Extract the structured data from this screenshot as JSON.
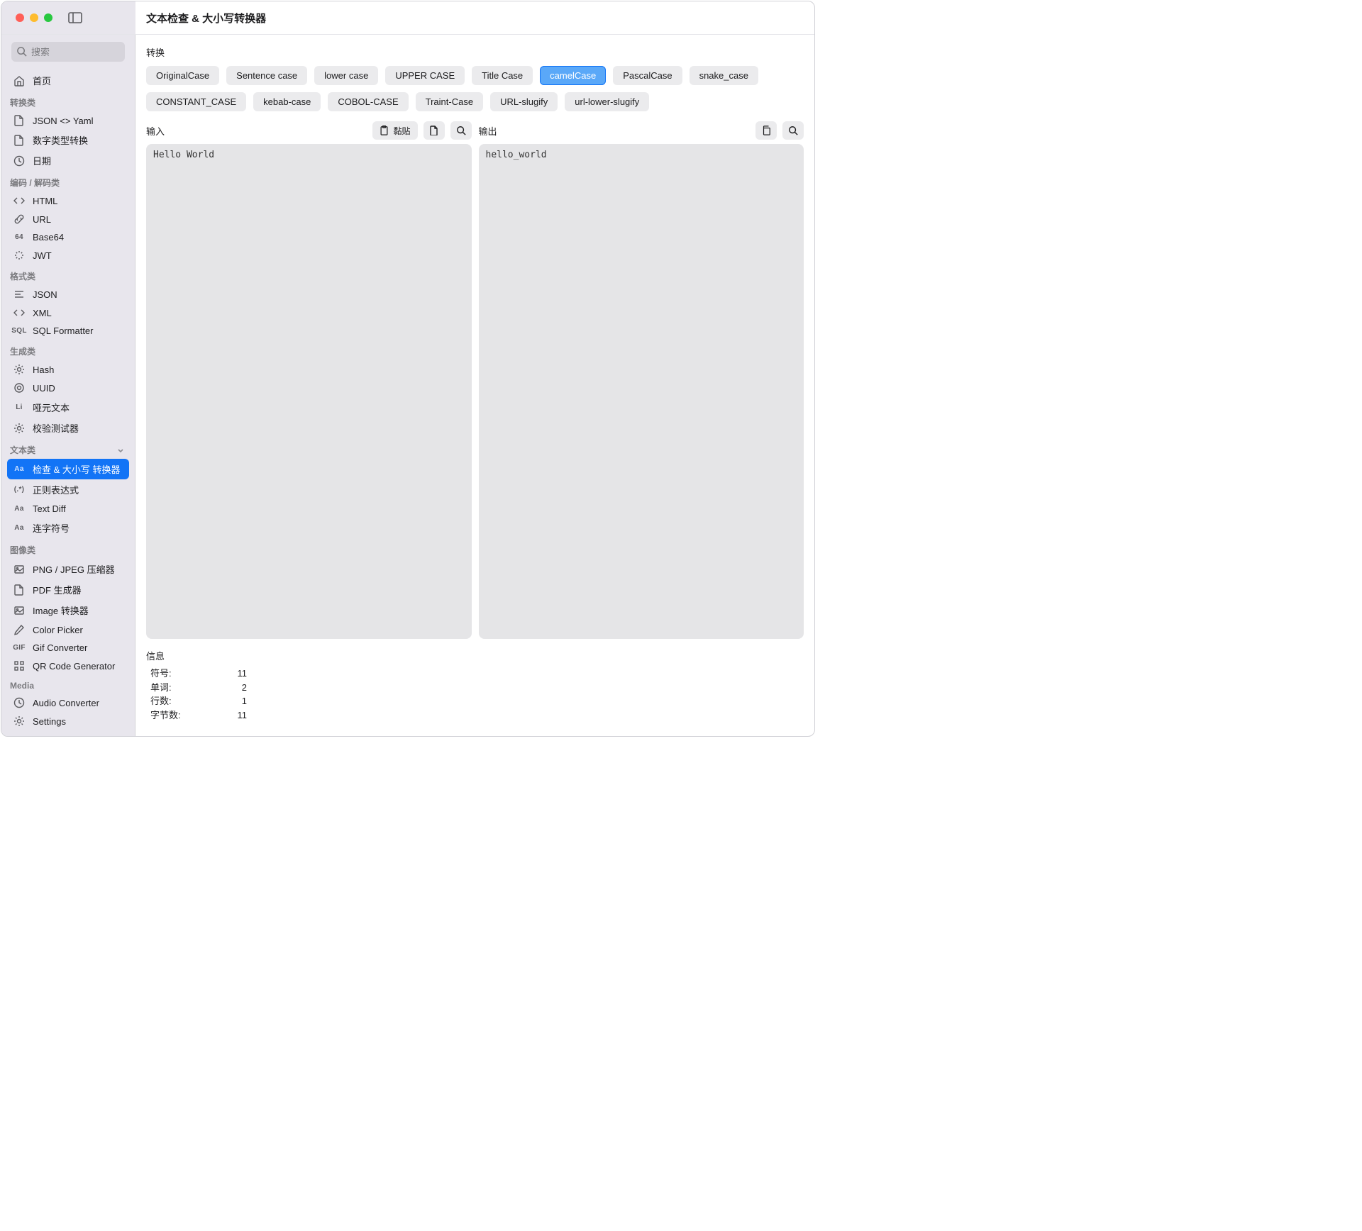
{
  "window_title": "文本检查 & 大小写转换器",
  "search": {
    "placeholder": "搜索"
  },
  "sidebar_home": "首页",
  "sidebar_sections": [
    {
      "title": "转换类",
      "items": [
        {
          "icon": "file",
          "label": "JSON <> Yaml"
        },
        {
          "icon": "file",
          "label": "数字类型转换"
        },
        {
          "icon": "clock",
          "label": "日期"
        }
      ]
    },
    {
      "title": "编码 / 解码类",
      "items": [
        {
          "icon": "code",
          "label": "HTML"
        },
        {
          "icon": "link",
          "label": "URL"
        },
        {
          "icon": "txt64",
          "label": "Base64"
        },
        {
          "icon": "spinner",
          "label": "JWT"
        }
      ]
    },
    {
      "title": "格式类",
      "items": [
        {
          "icon": "lines",
          "label": "JSON"
        },
        {
          "icon": "code",
          "label": "XML"
        },
        {
          "icon": "txtSQL",
          "label": "SQL Formatter"
        }
      ]
    },
    {
      "title": "生成类",
      "items": [
        {
          "icon": "gear",
          "label": "Hash"
        },
        {
          "icon": "circle",
          "label": "UUID"
        },
        {
          "icon": "txtLi",
          "label": "哑元文本"
        },
        {
          "icon": "gear",
          "label": "校验测试器"
        }
      ]
    },
    {
      "title": "文本类",
      "collapsible": true,
      "items": [
        {
          "icon": "txtAa",
          "label": "检查 & 大小写 转换器",
          "active": true
        },
        {
          "icon": "txtRegex",
          "label": "正则表达式"
        },
        {
          "icon": "txtAa",
          "label": "Text Diff"
        },
        {
          "icon": "txtAa",
          "label": "连字符号"
        }
      ]
    },
    {
      "title": "图像类",
      "items": [
        {
          "icon": "image",
          "label": "PNG / JPEG 压缩器"
        },
        {
          "icon": "file",
          "label": "PDF 生成器"
        },
        {
          "icon": "image",
          "label": "Image 转换器"
        },
        {
          "icon": "pen",
          "label": "Color Picker"
        },
        {
          "icon": "txtGIF",
          "label": "Gif Converter"
        },
        {
          "icon": "qr",
          "label": "QR Code Generator"
        }
      ]
    },
    {
      "title": "Media",
      "items": [
        {
          "icon": "clock",
          "label": "Audio Converter"
        },
        {
          "icon": "gear",
          "label": "Settings"
        }
      ]
    }
  ],
  "convert_label": "转换",
  "pills": [
    "OriginalCase",
    "Sentence case",
    "lower case",
    "UPPER CASE",
    "Title Case",
    "camelCase",
    "PascalCase",
    "snake_case",
    "CONSTANT_CASE",
    "kebab-case",
    "COBOL-CASE",
    "Traint-Case",
    "URL-slugify",
    "url-lower-slugify"
  ],
  "pill_active": "camelCase",
  "input_label": "输入",
  "output_label": "输出",
  "paste_label": "黏贴",
  "input_text": "Hello World",
  "output_text": "hello_world",
  "info_label": "信息",
  "info_rows": [
    {
      "key": "符号:",
      "val": "11"
    },
    {
      "key": "单词:",
      "val": "2"
    },
    {
      "key": "行数:",
      "val": "1"
    },
    {
      "key": "字节数:",
      "val": "11"
    }
  ]
}
